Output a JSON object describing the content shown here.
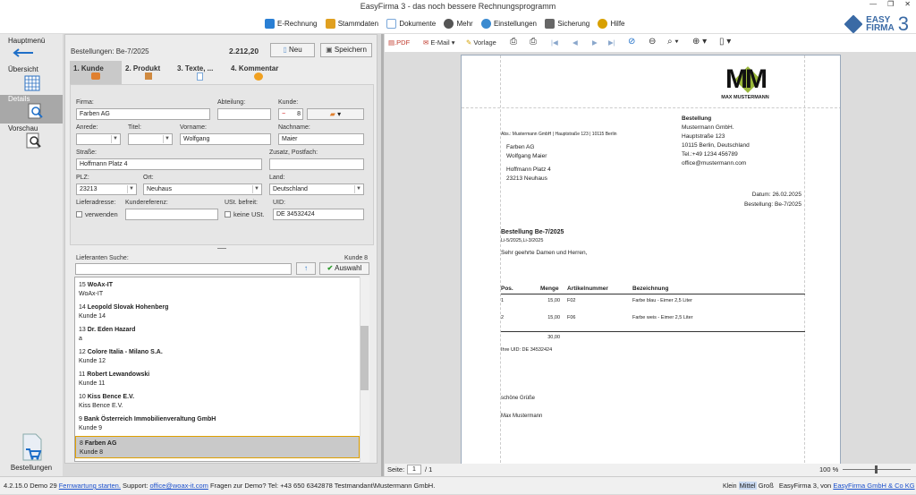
{
  "window": {
    "title": "EasyFirma 3 - das noch bessere Rechnungsprogramm"
  },
  "menu": [
    {
      "label": "E-Rechnung",
      "icon": "e-invoice-icon",
      "color": "#2a7fd4"
    },
    {
      "label": "Stammdaten",
      "icon": "master-data-icon",
      "color": "#e0a020"
    },
    {
      "label": "Dokumente",
      "icon": "documents-icon",
      "color": "#7aa7d9"
    },
    {
      "label": "Mehr",
      "icon": "more-icon",
      "color": "#555555"
    },
    {
      "label": "Einstellungen",
      "icon": "settings-icon",
      "color": "#3a8ad0"
    },
    {
      "label": "Sicherung",
      "icon": "backup-icon",
      "color": "#666666"
    },
    {
      "label": "Hilfe",
      "icon": "help-icon",
      "color": "#d8a000"
    }
  ],
  "logo": {
    "line1": "EASY",
    "line2": "FIRMA",
    "version": "3"
  },
  "nav": {
    "hauptmenue": "Hauptmenü",
    "uebersicht": "Übersicht",
    "details": "Details",
    "vorschau": "Vorschau",
    "bestellungen": "Bestellungen"
  },
  "form": {
    "doc_label": "Bestellungen: Be-7/2025",
    "total": "2.212,20",
    "new_button": "Neu",
    "save_button": "Speichern",
    "tabs": [
      "1. Kunde",
      "2. Produkt",
      "3. Texte, ...",
      "4. Kommentar"
    ],
    "labels": {
      "firma": "Firma:",
      "abteilung": "Abteilung:",
      "kunde": "Kunde:",
      "anrede": "Anrede:",
      "titel": "Titel:",
      "vorname": "Vorname:",
      "nachname": "Nachname:",
      "strasse": "Straße:",
      "zusatz": "Zusatz, Postfach:",
      "plz": "PLZ:",
      "ort": "Ort:",
      "land": "Land:",
      "lieferadresse": "Lieferadresse:",
      "kundenreferenz": "Kundereferenz:",
      "ust_befreit": "USt. befreit:",
      "uid": "UID:",
      "verwenden": "verwenden",
      "keine_ust": "keine USt."
    },
    "values": {
      "firma": "Farben AG",
      "abteilung": "",
      "kunde_nr": "8",
      "anrede": "",
      "titel": "",
      "vorname": "Wolfgang",
      "nachname": "Maier",
      "strasse": "Hoffmann Platz 4",
      "zusatz": "",
      "plz": "23213",
      "ort": "Neuhaus",
      "land": "Deutschland",
      "kundenreferenz": "",
      "uid": "DE 34532424"
    },
    "search_label": "Lieferanten Suche:",
    "search_value": "",
    "kunde_count": "Kunde 8",
    "select_button": "Auswahl"
  },
  "list": [
    {
      "num": "15",
      "name": "WoAx-IT",
      "sub": "WoAx-IT"
    },
    {
      "num": "14",
      "name": "Leopold Slovak Hohenberg",
      "sub": "Kunde 14"
    },
    {
      "num": "13",
      "name": "Dr. Eden Hazard",
      "sub": "a"
    },
    {
      "num": "12",
      "name": "Colore Italia - Milano S.A.",
      "sub": "Kunde 12"
    },
    {
      "num": "11",
      "name": "Robert Lewandowski",
      "sub": "Kunde 11"
    },
    {
      "num": "10",
      "name": "Kiss Bence E.V.",
      "sub": "Kiss Bence E.V."
    },
    {
      "num": "9",
      "name": "Bank Österreich Immobilienveraltung GmbH",
      "sub": "Kunde 9"
    },
    {
      "num": "8",
      "name": "Farben AG",
      "sub": "Kunde 8"
    }
  ],
  "preview_toolbar": {
    "pdf": ".PDF",
    "email": "E-Mail",
    "vorlage": "Vorlage"
  },
  "doc": {
    "logo_text": "MM",
    "logo_sub": "MAX MUSTERMANN",
    "sender_line": "Abs.: Mustermann GmbH | Hauptstraße 123 | 10115 Berlin",
    "recipient": [
      "Farben AG",
      "Wolfgang Maier",
      "",
      "Hoffmann Platz 4",
      "23213 Neuhaus"
    ],
    "sender_block": [
      "Bestellung",
      "Mustermann GmbH.",
      "Hauptstraße 123",
      "10115 Berlin, Deutschland",
      "Tel.:+49 1234 456789",
      "office@mustermann.com"
    ],
    "date": "Datum: 26.02.2025",
    "order_no": "Bestellung: Be-7/2025",
    "heading": "Bestellung Be-7/2025",
    "subheading": "Li-5/2025,Li-3/2025",
    "greeting": "Sehr geehrte Damen und Herren,",
    "table_headers": [
      "Pos.",
      "Menge",
      "Artikelnummer",
      "Bezeichnung"
    ],
    "rows": [
      {
        "pos": "1",
        "menge": "15,00",
        "art": "F02",
        "bez": "Farbe blau - Eimer 2,5 Liter"
      },
      {
        "pos": "2",
        "menge": "15,00",
        "art": "F06",
        "bez": "Farbe weis - Eimer 2,5 Liter"
      }
    ],
    "sum": "30,00",
    "uid_line": "Ihre UID: DE 34532424",
    "closing": "schöne Grüße",
    "signature": "Max Mustermann"
  },
  "preview_status": {
    "page_label": "Seite:",
    "page": "1",
    "of": "/ 1",
    "zoom": "100 %"
  },
  "status": {
    "version": "4.2.15.0 Demo 29",
    "maint_link": "Fernwartung starten.",
    "support_text": "Support:",
    "support_mail": "office@woax-it.com",
    "demo_text": "Fragen zur Demo? Tel: +43 650 6342878 Testmandant\\Mustermann GmbH.",
    "size_small": "Klein",
    "size_mid": "Mittel",
    "size_large": "Groß",
    "by": "EasyFirma 3, von",
    "company_link": "EasyFirma GmbH & Co KG"
  }
}
